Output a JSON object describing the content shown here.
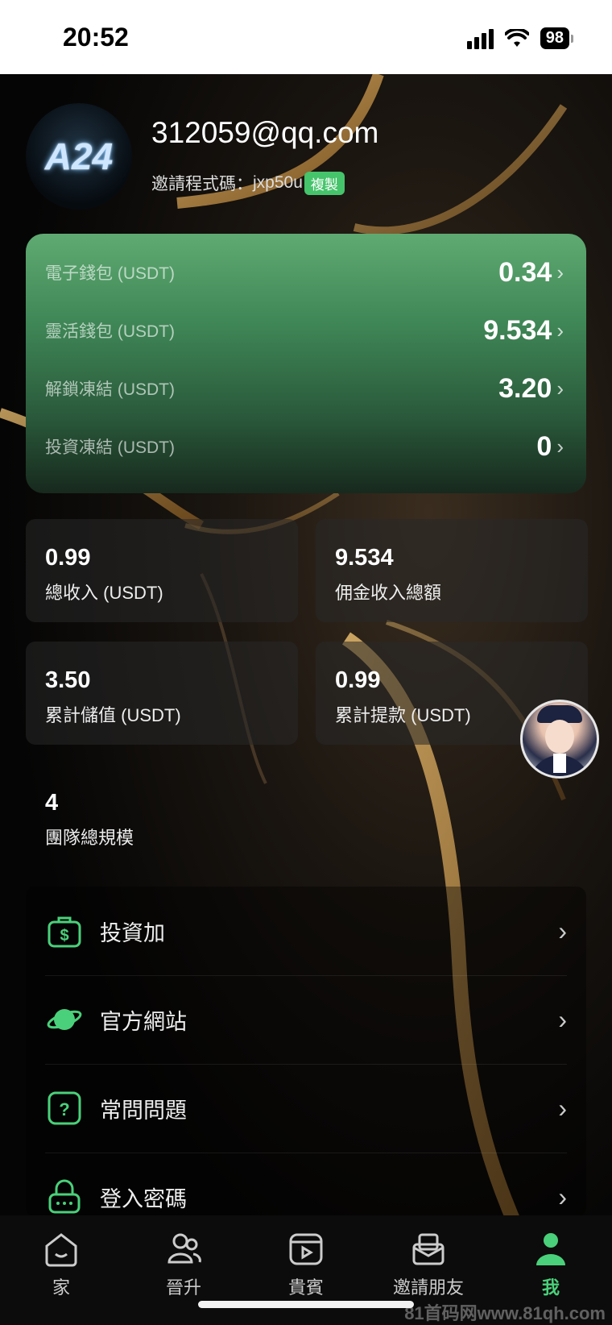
{
  "status_bar": {
    "time": "20:52",
    "battery": "98"
  },
  "profile": {
    "logo_text": "A24",
    "email": "312059@qq.com",
    "invite_label": "邀請程式碼：",
    "invite_code": "jxp50u",
    "copy_label": "複製"
  },
  "wallet": {
    "rows": [
      {
        "label": "電子錢包 (USDT)",
        "value": "0.34"
      },
      {
        "label": "靈活錢包 (USDT)",
        "value": "9.534"
      },
      {
        "label": "解鎖凍結 (USDT)",
        "value": "3.20"
      },
      {
        "label": "投資凍結 (USDT)",
        "value": "0"
      }
    ]
  },
  "stats": [
    {
      "value": "0.99",
      "label": "總收入 (USDT)"
    },
    {
      "value": "9.534",
      "label": "佣金收入總額"
    },
    {
      "value": "3.50",
      "label": "累計儲值 (USDT)"
    },
    {
      "value": "0.99",
      "label": "累計提款 (USDT)"
    },
    {
      "value": "4",
      "label": "團隊總規模"
    }
  ],
  "menu": [
    {
      "label": "投資加",
      "icon": "money-bag-icon"
    },
    {
      "label": "官方網站",
      "icon": "planet-icon"
    },
    {
      "label": "常問問題",
      "icon": "question-icon"
    },
    {
      "label": "登入密碼",
      "icon": "lock-icon"
    }
  ],
  "tabs": [
    {
      "label": "家",
      "icon": "home-icon"
    },
    {
      "label": "晉升",
      "icon": "users-icon"
    },
    {
      "label": "貴賓",
      "icon": "video-icon"
    },
    {
      "label": "邀請朋友",
      "icon": "invite-icon"
    },
    {
      "label": "我",
      "icon": "person-icon",
      "active": true
    }
  ],
  "colors": {
    "accent": "#4ad07a",
    "wallet_top": "#5faa72",
    "wallet_bottom": "#17291d"
  },
  "watermark": "81首码网www.81qh.com"
}
